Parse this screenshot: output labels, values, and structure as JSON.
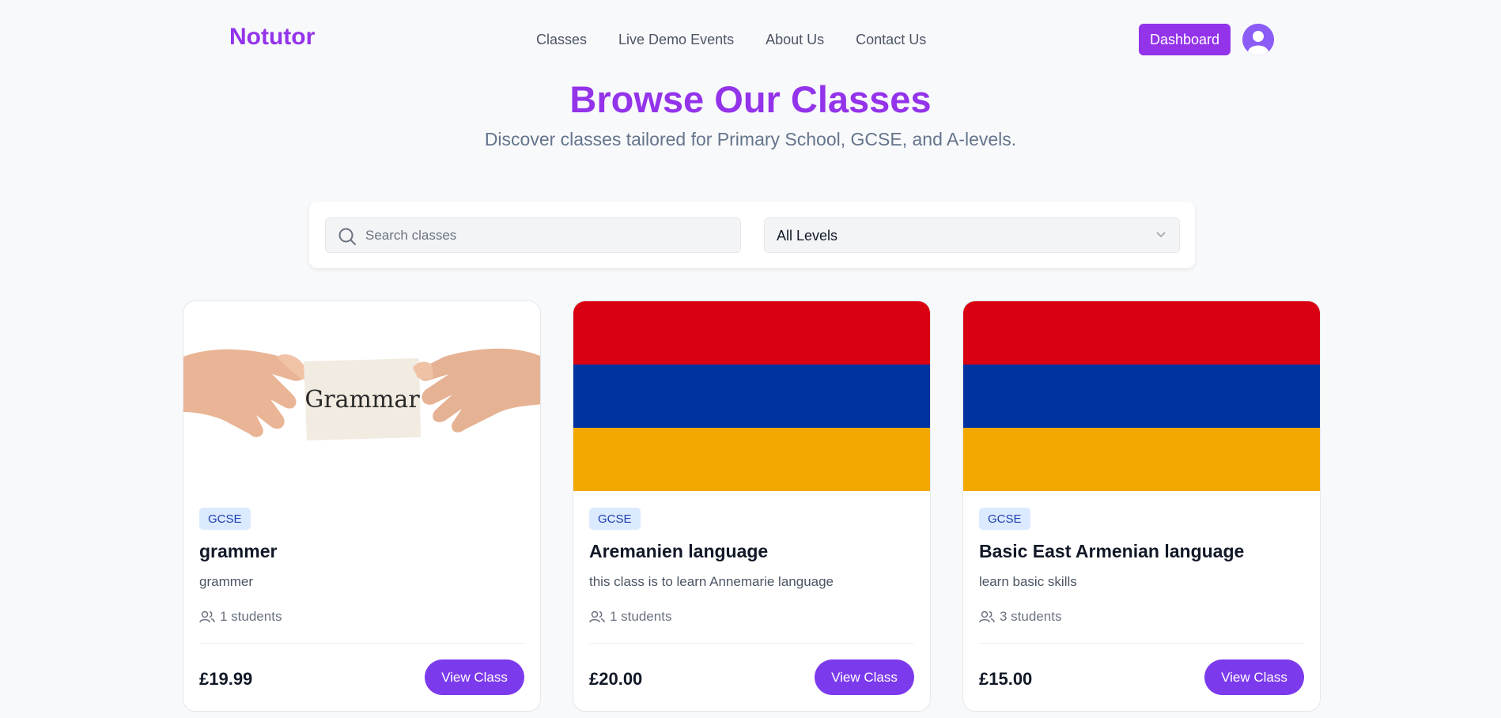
{
  "header": {
    "brand": "Notutor",
    "nav": [
      "Classes",
      "Live Demo Events",
      "About Us",
      "Contact Us"
    ],
    "dashboard_label": "Dashboard"
  },
  "hero": {
    "title": "Browse Our Classes",
    "subtitle": "Discover classes tailored for Primary School, GCSE, and A-levels."
  },
  "filters": {
    "search_placeholder": "Search classes",
    "level_selected": "All Levels"
  },
  "colors": {
    "accent": "#9333ea",
    "button": "#7c3aed",
    "flag_red": "#d90012",
    "flag_blue": "#0033a0",
    "flag_orange": "#f2a800"
  },
  "classes": [
    {
      "image_icon": "grammar-card-photo",
      "image_text": "Grammar",
      "level": "GCSE",
      "title": "grammer",
      "description": "grammer",
      "students": "1 students",
      "price": "£19.99",
      "button": "View Class"
    },
    {
      "image_icon": "armenian-flag",
      "level": "GCSE",
      "title": "Aremanien language",
      "description": "this class is to learn Annemarie language",
      "students": "1 students",
      "price": "£20.00",
      "button": "View Class"
    },
    {
      "image_icon": "armenian-flag",
      "level": "GCSE",
      "title": "Basic East Armenian language",
      "description": "learn basic skills",
      "students": "3 students",
      "price": "£15.00",
      "button": "View Class"
    }
  ]
}
